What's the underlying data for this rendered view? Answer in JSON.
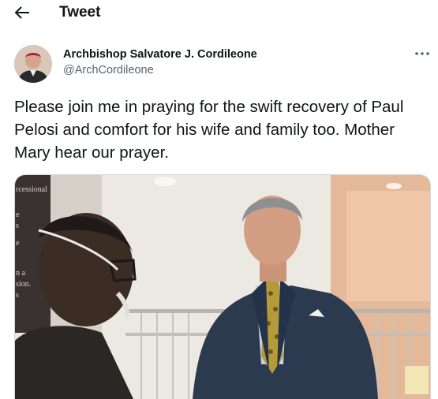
{
  "header": {
    "title": "Tweet",
    "back_icon": "arrow-left-icon"
  },
  "author": {
    "name": "Archbishop Salvatore J. Cordileone",
    "handle": "@ArchCordileone"
  },
  "more_icon": "ellipsis-icon",
  "tweet": {
    "text": "Please join me in praying for the swift recovery of Paul Pelosi and comfort for his wife and family too. Mother Mary hear our prayer."
  },
  "media": {
    "sign_text": [
      "rcessional",
      "e",
      "s",
      "e",
      "n a",
      "sion.",
      "s"
    ]
  },
  "colors": {
    "text": "#0f1419",
    "secondary": "#536471",
    "border": "#cfd9de"
  }
}
